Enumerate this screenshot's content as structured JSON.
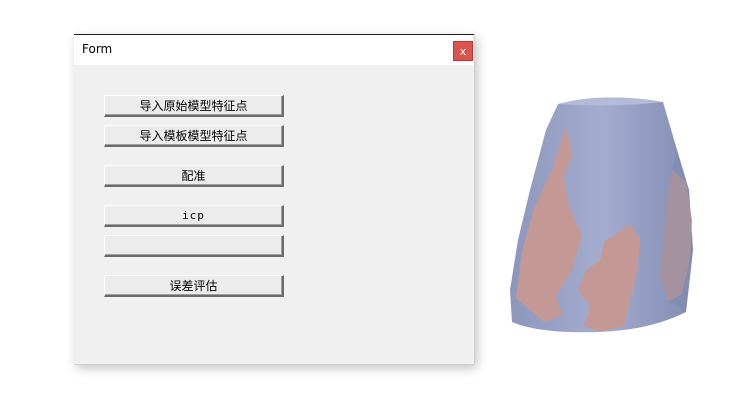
{
  "window": {
    "title": "Form",
    "close_label": "x"
  },
  "buttons": {
    "import_original": "导入原始模型特征点",
    "import_template": "导入模板模型特征点",
    "registration": "配准",
    "icp": "icp",
    "blank": "",
    "error_eval": "误差评估"
  },
  "model_view": {
    "icon": "3d-mesh-model",
    "colors": {
      "base": "#98a2c6",
      "overlay": "#c49995",
      "shade": "#7f89ad",
      "background": "#ffffff"
    }
  }
}
